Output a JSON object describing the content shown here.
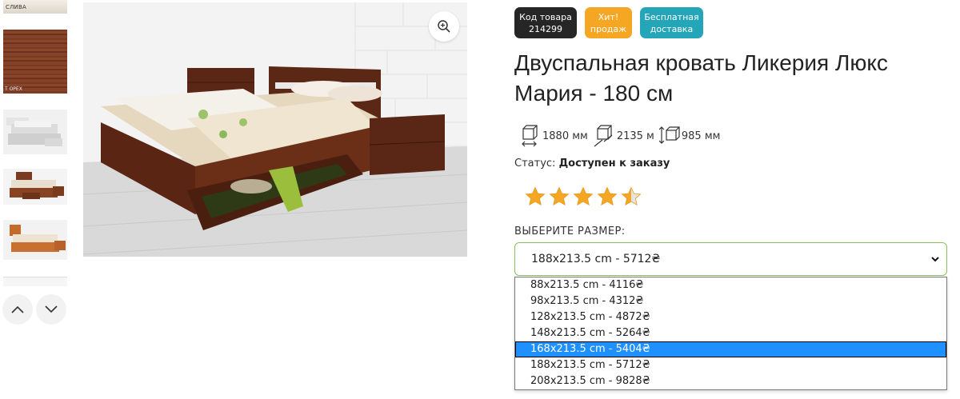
{
  "thumbnails": {
    "swatch_label": "СЛИВА",
    "swatch_label2": "Т ОРЕХ"
  },
  "badges": {
    "code_line1": "Код товара",
    "code_line2": "214299",
    "hit_line1": "Хит!",
    "hit_line2": "продаж",
    "shipping_line1": "Бесплатная",
    "shipping_line2": "доставка"
  },
  "product": {
    "title": "Двуспальная кровать Ликерия Люкс Мария - 180 см",
    "dims": {
      "length": "1880 мм",
      "width": "2135 м",
      "height": "985 мм"
    },
    "status_label": "Статус:",
    "status_value": "Доступен к заказу",
    "rating": 4.5
  },
  "size": {
    "label": "ВЫБЕРИТЕ РАЗМЕР:",
    "selected": "188x213.5 cm - 5712₴",
    "options": [
      "88x213.5 cm - 4116₴",
      "98x213.5 cm - 4312₴",
      "128x213.5 cm - 4872₴",
      "148x213.5 cm - 5264₴",
      "168x213.5 cm - 5404₴",
      "188x213.5 cm - 5712₴",
      "208x213.5 cm - 9828₴"
    ],
    "highlighted_index": 4
  },
  "colors": {
    "badge_code": "#262626",
    "badge_hit": "#f5a623",
    "badge_ship": "#24a5b8",
    "select_border": "#8bbf58",
    "highlight": "#1e90ff",
    "star": "#f5a623"
  }
}
